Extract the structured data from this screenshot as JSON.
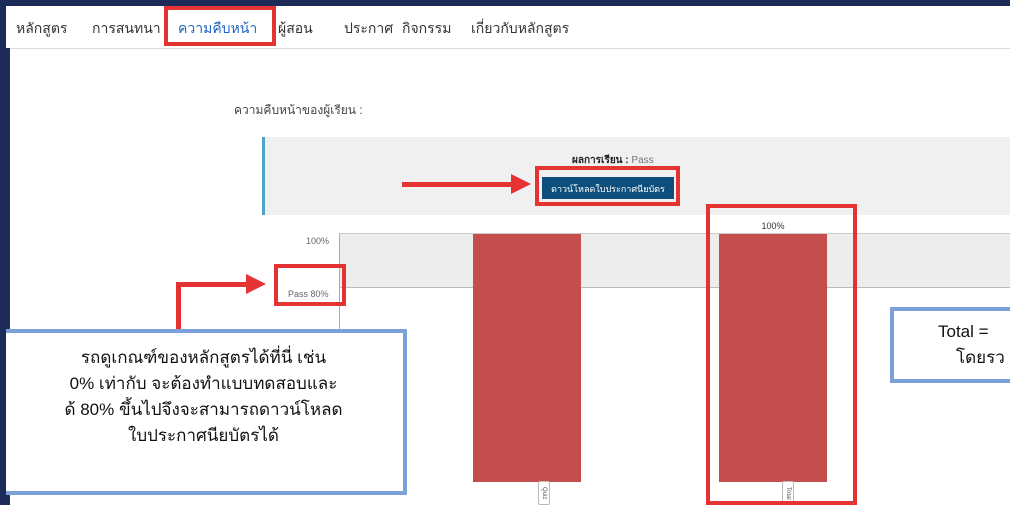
{
  "nav": {
    "items": [
      {
        "label": "หลักสูตร"
      },
      {
        "label": "การสนทนา"
      },
      {
        "label": "ความคืบหน้า"
      },
      {
        "label": "ผู้สอน"
      },
      {
        "label": "ประกาศ"
      },
      {
        "label": "กิจกรรม"
      },
      {
        "label": "เกี่ยวกับหลักสูตร"
      }
    ],
    "active": "ความคืบหน้า"
  },
  "progress": {
    "heading": "ความคืบหน้าของผู้เรียน :",
    "result_label": "ผลการเรียน",
    "result_separator": ":",
    "result_value": "Pass",
    "download_button": "ดาวน์โหลดใบประกาศนียบัตร"
  },
  "chart_data": {
    "type": "bar",
    "categories": [
      "Quiz",
      "Total"
    ],
    "values": [
      100,
      100
    ],
    "data_labels": [
      "",
      "100%"
    ],
    "yticks": [
      "100%"
    ],
    "pass_label": "Pass 80%",
    "pass_value": 80,
    "ylim": [
      0,
      100
    ],
    "colors": {
      "bar": "#c44d4d",
      "band": "#ededed"
    }
  },
  "callouts": {
    "left_lines": [
      "รถดูเกณฑ์ของหลักสูตรได้ที่นี่ เช่น",
      "0% เท่ากับ จะต้องทำแบบทดสอบและ",
      "ด้ 80% ขึ้นไปจึงจะสามารถดาวน์โหลด",
      "ใบประกาศนียบัตรได้"
    ],
    "right_lines": [
      "Total =",
      "โดยรว"
    ]
  },
  "colors": {
    "accent": "#1f66c2",
    "highlight": "#e53333",
    "callout_border": "#7da0d8",
    "button": "#0d4f7c"
  }
}
